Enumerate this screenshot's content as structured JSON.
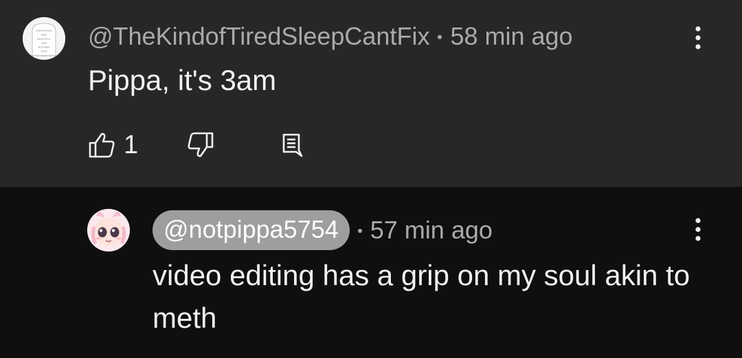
{
  "comment": {
    "avatar_text": "EVERYTHING WAS BEAUTIFUL AND NOTHING HURT",
    "handle": "@TheKindofTiredSleepCantFix",
    "time": "58 min ago",
    "text": "Pippa, it's 3am",
    "like_count": "1"
  },
  "reply": {
    "handle": "@notpippa5754",
    "time": "57 min ago",
    "text": "video editing has a grip on my soul akin to meth"
  },
  "icons": {
    "like": "thumbs-up-icon",
    "dislike": "thumbs-down-icon",
    "reply": "reply-comment-icon",
    "more": "more-vertical-icon"
  },
  "colors": {
    "comment_bg": "#272727",
    "reply_bg": "#0f0f0f",
    "meta_text": "#aaaaaa",
    "body_text": "#f1f1f1",
    "handle_pill": "#9e9e9e"
  }
}
